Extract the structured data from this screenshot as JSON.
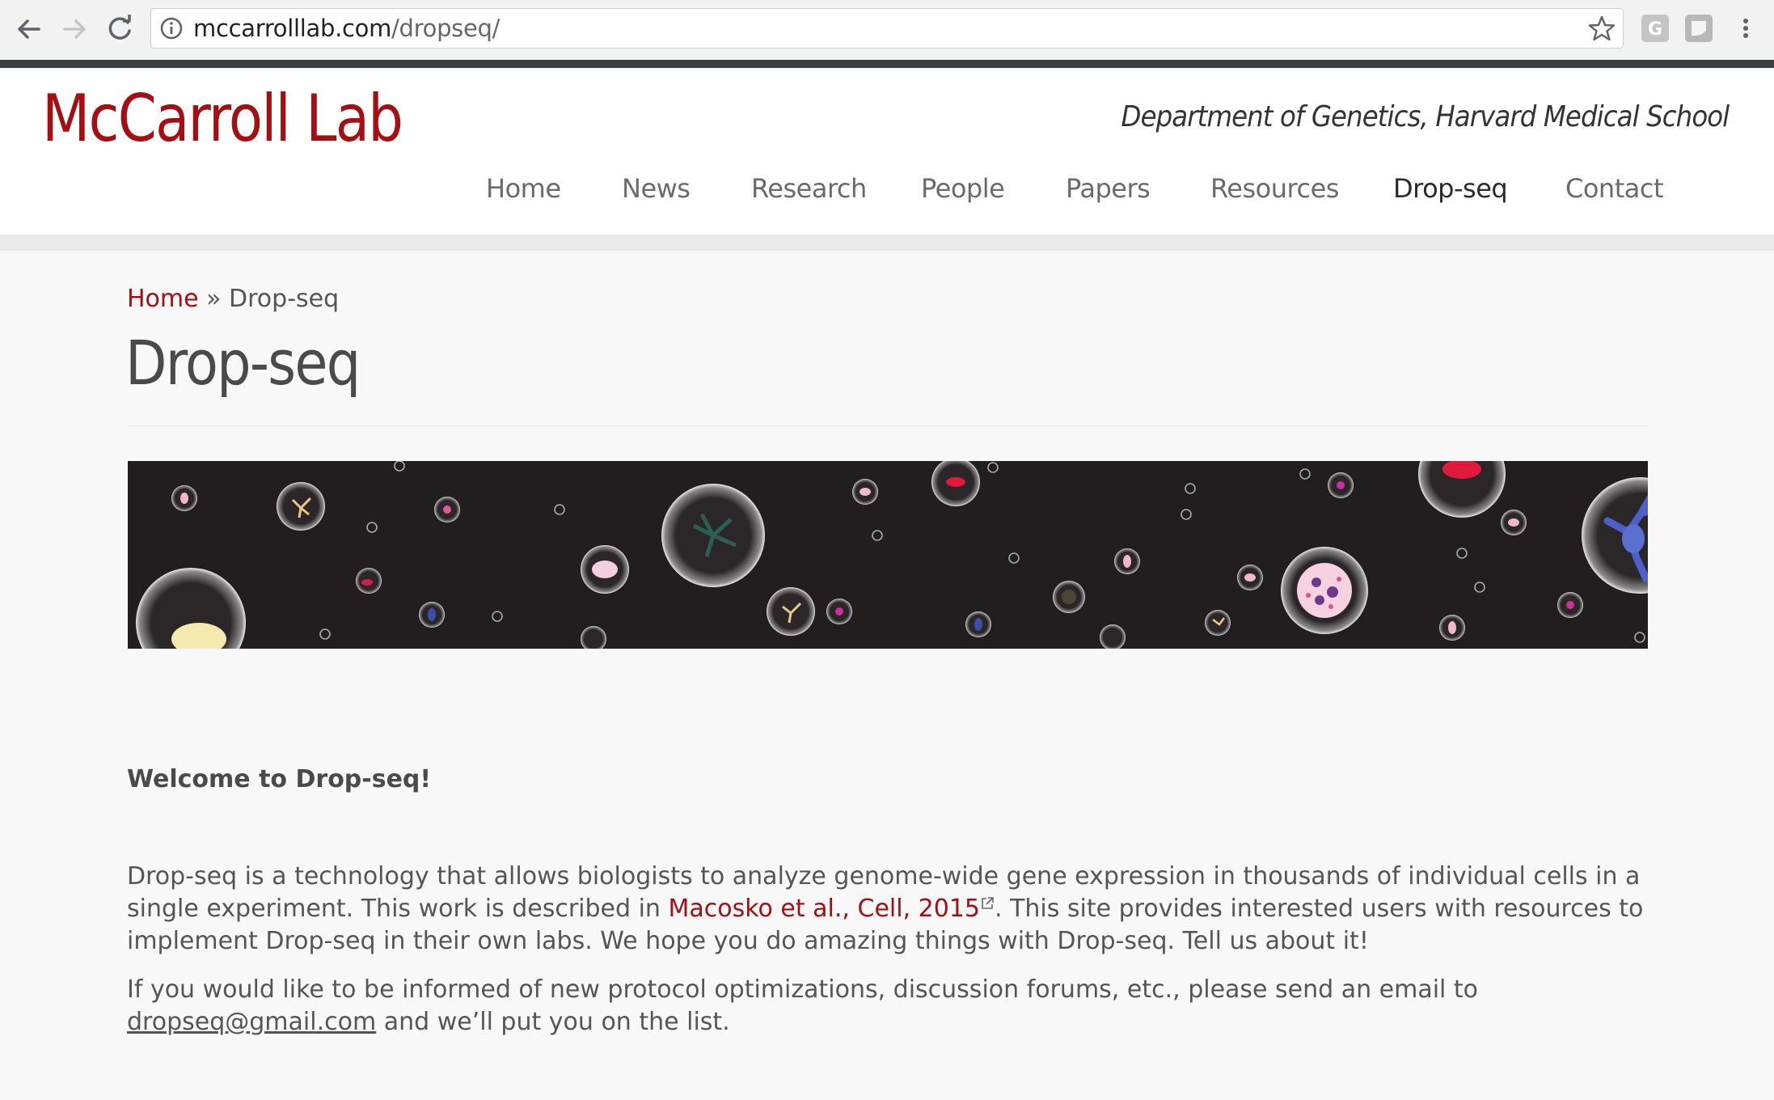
{
  "browser": {
    "url_host": "mccarrolllab.com",
    "url_path": "/dropseq/"
  },
  "site": {
    "logo": "McCarroll Lab",
    "department": "Department of Genetics, Harvard Medical School",
    "nav": [
      "Home",
      "News",
      "Research",
      "People",
      "Papers",
      "Resources",
      "Drop-seq",
      "Contact"
    ],
    "active_nav": "Drop-seq"
  },
  "breadcrumb": {
    "home": "Home",
    "separator": " » ",
    "current": "Drop-seq"
  },
  "page_title": "Drop-seq",
  "welcome": "Welcome to Drop-seq!",
  "paragraph1": {
    "before_link": "Drop-seq is a technology that allows biologists to analyze genome-wide gene expression in thousands of individual cells in a single experiment.  This work is described in ",
    "link_text": "Macosko et al., Cell, 2015",
    "after_link": ".  This site provides interested users with resources to implement Drop-seq in their own labs.  We hope you do amazing things with Drop-seq.  Tell us about it!"
  },
  "paragraph2": {
    "before_email": "If you would like to be informed of new protocol optimizations, discussion forums, etc., please send an email to ",
    "email": "dropseq@gmail.com",
    "after_email": " and we’ll put you on the list."
  },
  "colors": {
    "brand_red": "#a30f12",
    "banner_bg": "#221e1f",
    "chrome_bar": "#3c3f43"
  }
}
